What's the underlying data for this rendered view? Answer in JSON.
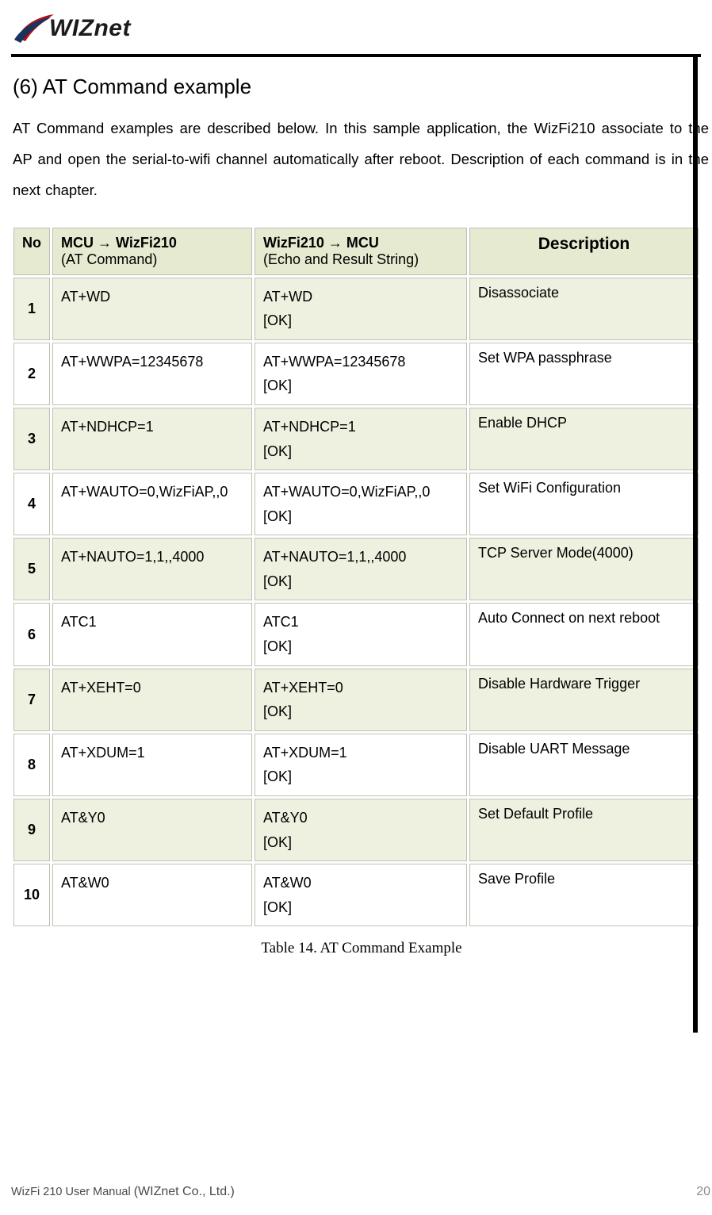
{
  "logo_text": "WIZnet",
  "section_title": "(6)  AT Command example",
  "intro": "AT Command examples are described below. In this sample application, the WizFi210 associate to the AP and open the serial-to-wifi channel automatically after reboot. Description of each command is in the next chapter.",
  "headers": {
    "no": "No",
    "mcu_main": "MCU → WizFi210",
    "mcu_sub": "(AT Command)",
    "echo_main": "WizFi210 → MCU",
    "echo_sub": "(Echo and Result String)",
    "desc": "Description"
  },
  "rows": [
    {
      "no": "1",
      "cmd": "AT+WD",
      "echo1": "AT+WD",
      "echo2": "[OK]",
      "desc": "Disassociate"
    },
    {
      "no": "2",
      "cmd": "AT+WWPA=12345678",
      "echo1": "AT+WWPA=12345678",
      "echo2": "[OK]",
      "desc": "Set WPA passphrase"
    },
    {
      "no": "3",
      "cmd": "AT+NDHCP=1",
      "echo1": "AT+NDHCP=1",
      "echo2": "[OK]",
      "desc": "Enable DHCP"
    },
    {
      "no": "4",
      "cmd": "AT+WAUTO=0,WizFiAP,,0",
      "echo1": "AT+WAUTO=0,WizFiAP,,0",
      "echo2": "[OK]",
      "desc": "Set WiFi Configuration"
    },
    {
      "no": "5",
      "cmd": "AT+NAUTO=1,1,,4000",
      "echo1": "AT+NAUTO=1,1,,4000",
      "echo2": "[OK]",
      "desc": "TCP Server Mode(4000)"
    },
    {
      "no": "6",
      "cmd": "ATC1",
      "echo1": "ATC1",
      "echo2": "[OK]",
      "desc": "Auto Connect on next reboot"
    },
    {
      "no": "7",
      "cmd": "AT+XEHT=0",
      "echo1": "AT+XEHT=0",
      "echo2": "[OK]",
      "desc": "Disable   Hardware Trigger"
    },
    {
      "no": "8",
      "cmd": "AT+XDUM=1",
      "echo1": "AT+XDUM=1",
      "echo2": "[OK]",
      "desc": "Disable UART Message"
    },
    {
      "no": "9",
      "cmd": "AT&Y0",
      "echo1": "AT&Y0",
      "echo2": "[OK]",
      "desc": "Set Default Profile"
    },
    {
      "no": "10",
      "cmd": "AT&W0",
      "echo1": "AT&W0",
      "echo2": "[OK]",
      "desc": "Save Profile"
    }
  ],
  "caption": "Table 14. AT Command Example",
  "footer_doc": "WizFi 210 User Manual ",
  "footer_company": "(WIZnet Co., Ltd.)",
  "page_number": "20"
}
